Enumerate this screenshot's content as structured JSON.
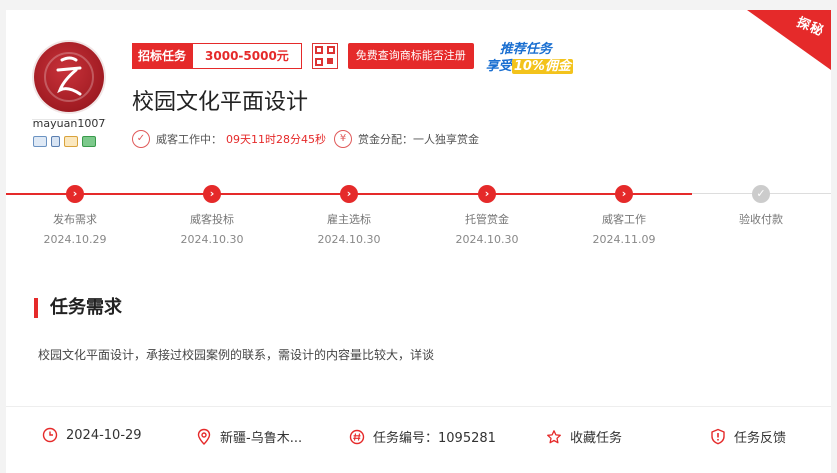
{
  "ribbon": {
    "label": "探秘"
  },
  "employer": {
    "username": "mayuan1007"
  },
  "task": {
    "kind": "招标任务",
    "price_range": "3000-5000元",
    "trademark_button": "免费查询商标能否注册",
    "promo_line1": "推荐任务",
    "promo_line2_prefix": "享受",
    "promo_line2_highlight": "10%佣金",
    "title": "校园文化平面设计",
    "status_label": "威客工作中：",
    "countdown": "09天11时28分45秒",
    "reward_icon": "¥",
    "reward_label": "赏金分配：一人独享赏金"
  },
  "progress": {
    "steps": [
      {
        "name": "发布需求",
        "date": "2024.10.29",
        "done": true
      },
      {
        "name": "威客投标",
        "date": "2024.10.30",
        "done": true
      },
      {
        "name": "雇主选标",
        "date": "2024.10.30",
        "done": true
      },
      {
        "name": "托管赏金",
        "date": "2024.10.30",
        "done": true
      },
      {
        "name": "威客工作",
        "date": "2024.11.09",
        "done": true
      },
      {
        "name": "验收付款",
        "date": "",
        "done": false
      }
    ]
  },
  "requirement": {
    "heading": "任务需求",
    "text": "校园文化平面设计，承接过校园案例的联系，需设计的内容量比较大，详谈"
  },
  "footer": {
    "date": "2024-10-29",
    "location": "新疆-乌鲁木...",
    "task_no": "任务编号：1095281",
    "favorite": "收藏任务",
    "feedback": "任务反馈"
  },
  "colors": {
    "accent": "#e52a2a",
    "promo_blue": "#1a6fd1",
    "promo_yellow": "#f3c31c"
  }
}
